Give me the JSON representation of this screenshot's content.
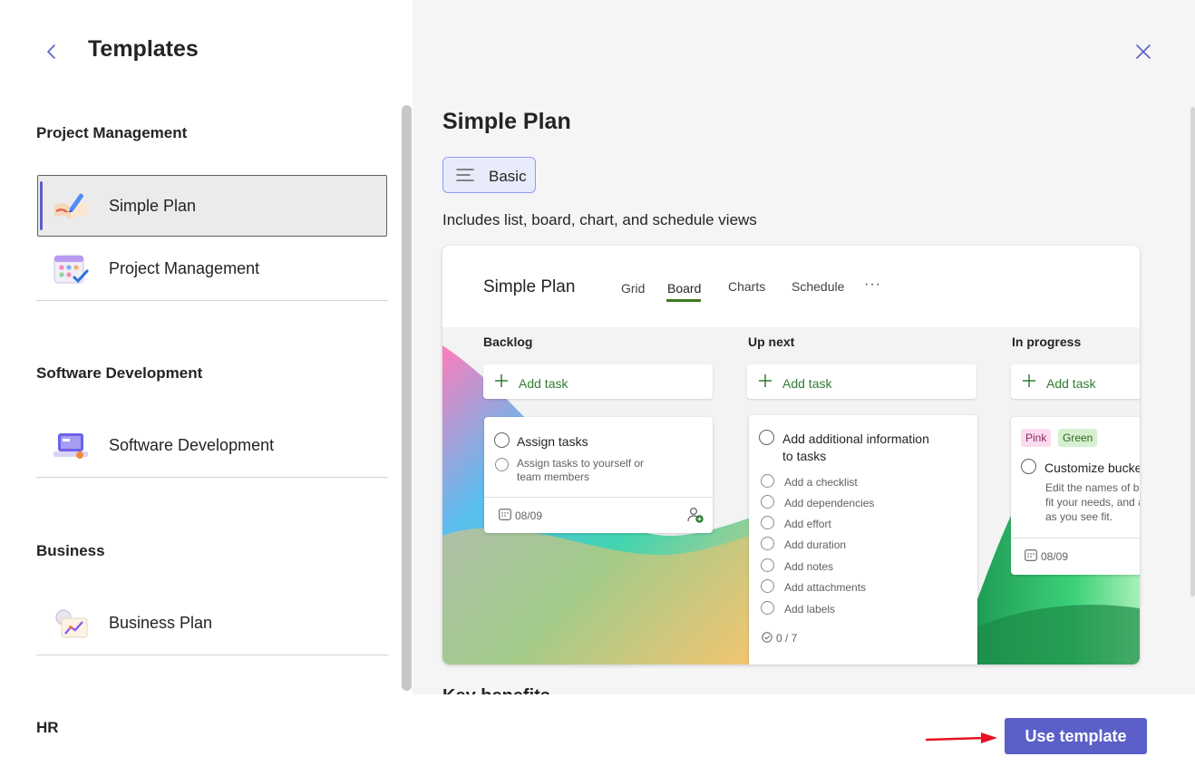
{
  "header": {
    "title": "Templates"
  },
  "categories": [
    {
      "name": "Project Management",
      "items": [
        {
          "label": "Simple Plan",
          "selected": true
        },
        {
          "label": "Project Management"
        }
      ]
    },
    {
      "name": "Software Development",
      "items": [
        {
          "label": "Software Development"
        }
      ]
    },
    {
      "name": "Business",
      "items": [
        {
          "label": "Business Plan"
        }
      ]
    },
    {
      "name": "HR",
      "items": []
    }
  ],
  "detail": {
    "title": "Simple Plan",
    "badge": "Basic",
    "description": "Includes list, board, chart, and schedule views",
    "section_heading": "Key benefits"
  },
  "preview": {
    "title": "Simple Plan",
    "tabs": [
      "Grid",
      "Board",
      "Charts",
      "Schedule"
    ],
    "active_tab": "Board",
    "more": "···",
    "columns": [
      {
        "name": "Backlog",
        "add_label": "Add task"
      },
      {
        "name": "Up next",
        "add_label": "Add task"
      },
      {
        "name": "In progress",
        "add_label": "Add task"
      }
    ],
    "backlog_card": {
      "task": "Assign tasks",
      "sub_line1": "Assign tasks to yourself or",
      "sub_line2": "team members",
      "date": "08/09"
    },
    "upnext_card": {
      "task_line1": "Add additional information",
      "task_line2": "to tasks",
      "subtasks": [
        "Add a checklist",
        "Add dependencies",
        "Add effort",
        "Add duration",
        "Add notes",
        "Add attachments",
        "Add labels"
      ],
      "progress": "0 / 7"
    },
    "inprogress_card": {
      "tags": [
        "Pink",
        "Green"
      ],
      "task": "Customize buckets",
      "sub_line1": "Edit the names of buckets to",
      "sub_line2": "fit your needs, and add more",
      "sub_line3": "as you see fit.",
      "date": "08/09"
    }
  },
  "footer": {
    "use_template": "Use template"
  },
  "colors": {
    "accent": "#5b5fc7",
    "badge_bg": "#e8ebfa",
    "green": "#2e7d32",
    "arrow": "#e81123"
  }
}
